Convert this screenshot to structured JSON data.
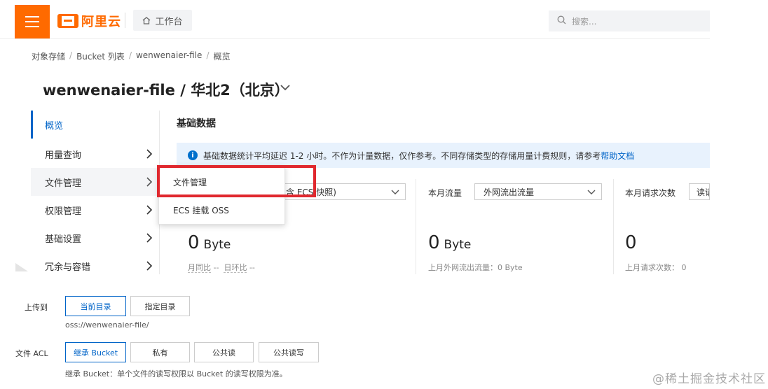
{
  "topbar": {
    "logo_text": "阿里云",
    "workbench_label": "工作台",
    "search_placeholder": "搜索..."
  },
  "breadcrumb": [
    "对象存储",
    "Bucket 列表",
    "wenwenaier-file",
    "概览"
  ],
  "page": {
    "title_bucket": "wenwenaier-file",
    "title_sep": " / ",
    "title_region": "华北2（北京）"
  },
  "sidenav": {
    "items": [
      {
        "label": "概览"
      },
      {
        "label": "用量查询"
      },
      {
        "label": "文件管理"
      },
      {
        "label": "权限管理"
      },
      {
        "label": "基础设置"
      },
      {
        "label": "冗余与容错"
      }
    ]
  },
  "popup": {
    "items": [
      {
        "label": "文件管理"
      },
      {
        "label": "ECS 挂载 OSS"
      }
    ]
  },
  "main": {
    "section_title": "基础数据",
    "info_text": "基础数据统计平均延迟 1-2 小时。不作为计量数据，仅作参考。不同存储类型的存储用量计费规则，请参考",
    "info_link": "帮助文档",
    "col1": {
      "select_value": "含 ECS 快照)",
      "value": "0",
      "unit": "Byte",
      "sub_mom_label": "月同比",
      "sub_mom_value": "--",
      "sub_dod_label": "日环比",
      "sub_dod_value": "--"
    },
    "col2": {
      "label": "本月流量",
      "select_value": "外网流出流量",
      "value": "0",
      "unit": "Byte",
      "sub": "上月外网流出流量：0 Byte"
    },
    "col3": {
      "label": "本月请求次数",
      "select_value": "读请",
      "value": "0",
      "sub": "上月请求次数：  0"
    }
  },
  "form": {
    "upload_to_label": "上传到",
    "upload_options": [
      "当前目录",
      "指定目录"
    ],
    "upload_path": "oss://wenwenaier-file/",
    "acl_label": "文件 ACL",
    "acl_options": [
      "继承 Bucket",
      "私有",
      "公共读",
      "公共读写"
    ],
    "acl_hint": "继承 Bucket：单个文件的读写权限以 Bucket 的读写权限为准。"
  },
  "watermark": "@稀土掘金技术社区",
  "colors": {
    "brand": "#ff6a00",
    "accent": "#0064c8",
    "highlight": "#e0282e",
    "info_bg": "#e8f2fd"
  }
}
